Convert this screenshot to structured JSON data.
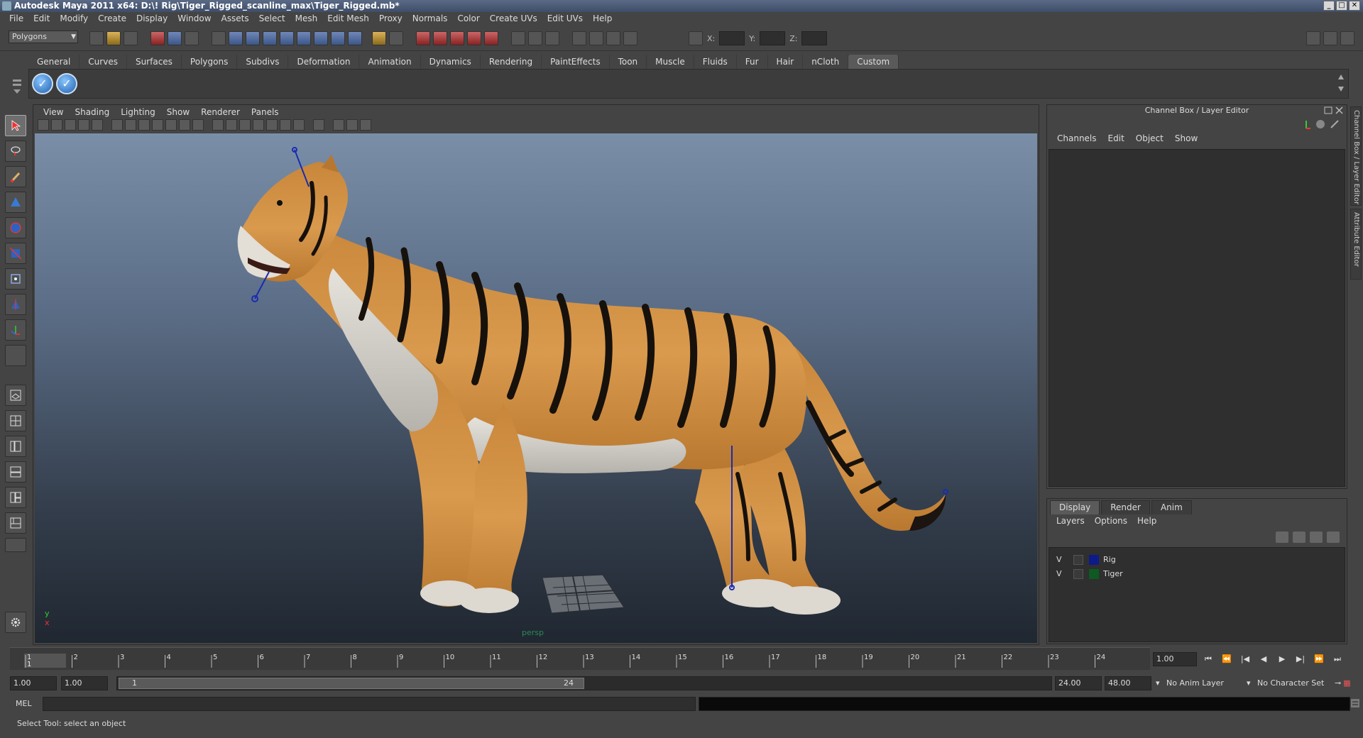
{
  "window": {
    "title": "Autodesk Maya 2011 x64: D:\\! Rig\\Tiger_Rigged_scanline_max\\Tiger_Rigged.mb*",
    "minimize": "_",
    "maximize": "□",
    "close": "✕"
  },
  "menubar": [
    "File",
    "Edit",
    "Modify",
    "Create",
    "Display",
    "Window",
    "Assets",
    "Select",
    "Mesh",
    "Edit Mesh",
    "Proxy",
    "Normals",
    "Color",
    "Create UVs",
    "Edit UVs",
    "Help"
  ],
  "status": {
    "mode": "Polygons",
    "coord_labels": [
      "X:",
      "Y:",
      "Z:"
    ]
  },
  "shelf": {
    "tabs": [
      "General",
      "Curves",
      "Surfaces",
      "Polygons",
      "Subdivs",
      "Deformation",
      "Animation",
      "Dynamics",
      "Rendering",
      "PaintEffects",
      "Toon",
      "Muscle",
      "Fluids",
      "Fur",
      "Hair",
      "nCloth",
      "Custom"
    ],
    "active_tab": "Custom",
    "button_glyph": "✓"
  },
  "viewport": {
    "menu": [
      "View",
      "Shading",
      "Lighting",
      "Show",
      "Renderer",
      "Panels"
    ],
    "camera": "persp",
    "axis_y": "y",
    "axis_x": "x"
  },
  "channel_box": {
    "title": "Channel Box / Layer Editor",
    "menu": [
      "Channels",
      "Edit",
      "Object",
      "Show"
    ]
  },
  "layer_editor": {
    "tabs": [
      "Display",
      "Render",
      "Anim"
    ],
    "active_tab": "Display",
    "menu": [
      "Layers",
      "Options",
      "Help"
    ],
    "layers": [
      {
        "visible": "V",
        "name": "Rig",
        "color": "#0d1b8a"
      },
      {
        "visible": "V",
        "name": "Tiger",
        "color": "#0d5a22"
      }
    ]
  },
  "side_tabs": [
    "Channel Box / Layer Editor",
    "Attribute Editor"
  ],
  "timeline": {
    "ticks": [
      "1",
      "2",
      "3",
      "4",
      "5",
      "6",
      "7",
      "8",
      "9",
      "10",
      "11",
      "12",
      "13",
      "14",
      "15",
      "16",
      "17",
      "18",
      "19",
      "20",
      "21",
      "22",
      "23",
      "24"
    ],
    "current_frame": "1.00",
    "current_frame_marker": "1"
  },
  "range": {
    "start": "1.00",
    "playback_start": "1.00",
    "thumb_start": "1",
    "thumb_end": "24",
    "playback_end": "24.00",
    "end": "48.00",
    "anim_layer": "No Anim Layer",
    "character_set": "No Character Set"
  },
  "command_line": {
    "label": "MEL"
  },
  "help_line": {
    "text": "Select Tool: select an object"
  },
  "colors": {
    "accent": "#5a5a5a",
    "viewport_top": "#7a8ea8",
    "viewport_bottom": "#202731"
  }
}
